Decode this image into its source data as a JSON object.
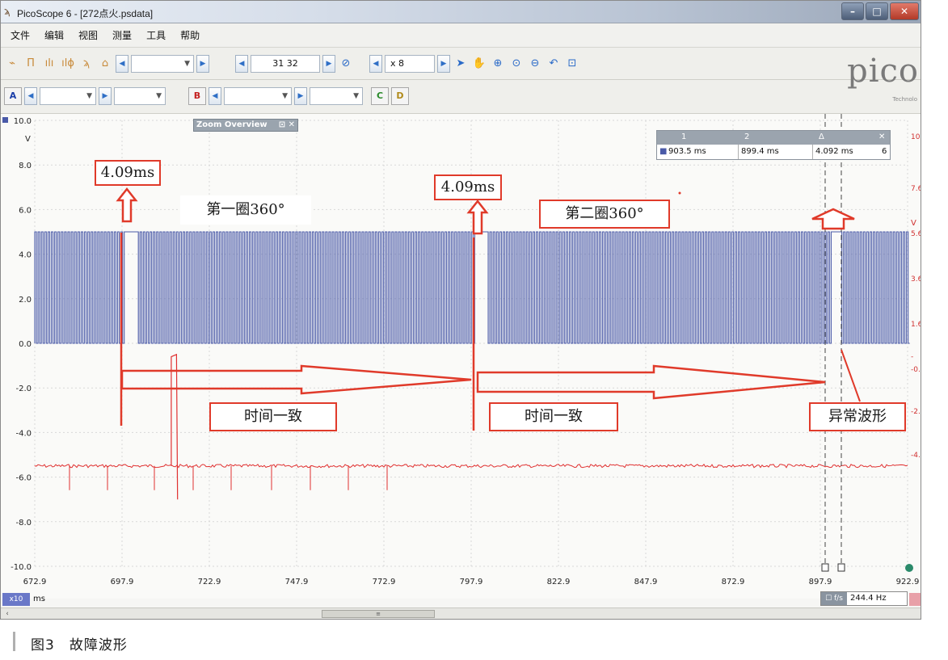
{
  "window": {
    "title": "PicoScope 6 - [272点火.psdata]",
    "buttons": [
      "–",
      "□",
      "✕"
    ]
  },
  "menu": [
    "文件",
    "编辑",
    "视图",
    "测量",
    "工具",
    "帮助"
  ],
  "toolbar": {
    "buffer_value": "31 32",
    "zoom_value": "x 8"
  },
  "logo": {
    "text": "pico",
    "sub": "Technolo"
  },
  "channels": {
    "a": "A",
    "b": "B",
    "c": "C",
    "d": "D"
  },
  "zoom_overview": {
    "title": "Zoom Overview",
    "controls": "⊡ ✕"
  },
  "ruler": {
    "headers": [
      "1",
      "2",
      "Δ"
    ],
    "values": [
      "903.5 ms",
      "899.4 ms",
      "4.092 ms"
    ],
    "extra": "6"
  },
  "axes": {
    "left_unit": "V",
    "right_unit": "V",
    "x_unit": "ms",
    "x_unit_tag": "x10",
    "left_ticks": [
      "10.0",
      "8.0",
      "6.0",
      "4.0",
      "2.0",
      "0.0",
      "-2.0",
      "-4.0",
      "-6.0",
      "-8.0",
      "-10.0"
    ],
    "right_ticks": [
      "10.",
      "7.6",
      "5.6",
      "3.6",
      "1.6",
      "-",
      "-0.",
      "-2.",
      "-4."
    ],
    "x_ticks": [
      "672.9",
      "697.9",
      "722.9",
      "747.9",
      "772.9",
      "797.9",
      "822.9",
      "847.9",
      "872.9",
      "897.9",
      "922.9"
    ]
  },
  "frequency": {
    "tag": "☐ f/s",
    "value": "244.4 Hz"
  },
  "annotations": {
    "period1": "4.09ms",
    "period2": "4.09ms",
    "turn1": "第一圈360°",
    "turn2": "第二圈360°",
    "same_time1": "时间一致",
    "same_time2": "时间一致",
    "abnormal": "异常波形"
  },
  "colors": {
    "channel_a": "#4a5aa8",
    "channel_b": "#e03030",
    "annotation": "#e03a2a"
  },
  "caption": "图3　故障波形",
  "scroll_thumb_glyph": "≡"
}
